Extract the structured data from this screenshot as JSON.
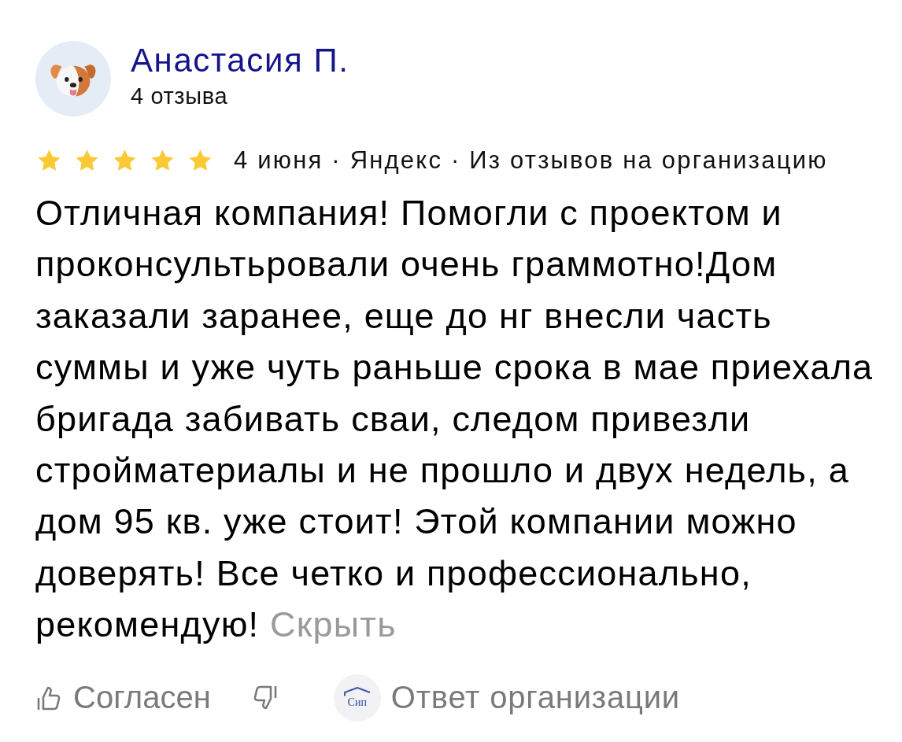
{
  "review": {
    "author": {
      "name": "Анастасия П.",
      "reviews_count": "4 отзыва"
    },
    "stars": 5,
    "meta": "4 июня · Яндекс · Из отзывов на организацию",
    "text_lines": [
      "Отличная компания! Помогли с проектом и",
      "проконсультьровали очень граммотно!Дом",
      "заказали заранее, еще до нг внесли часть",
      "суммы и уже чуть раньше срока в мае приехала",
      "бригада забивать сваи, следом привезли",
      "стройматериалы и не прошло и двух недель, а",
      "дом 95 кв. уже стоит! Этой компании можно",
      "доверять! Все четко и профессионально,",
      "рекомендую!"
    ],
    "hide_link": "Скрыть"
  },
  "actions": {
    "agree": "Согласен",
    "org_response": {
      "logo_text": "Сип",
      "label": "Ответ организации"
    }
  }
}
